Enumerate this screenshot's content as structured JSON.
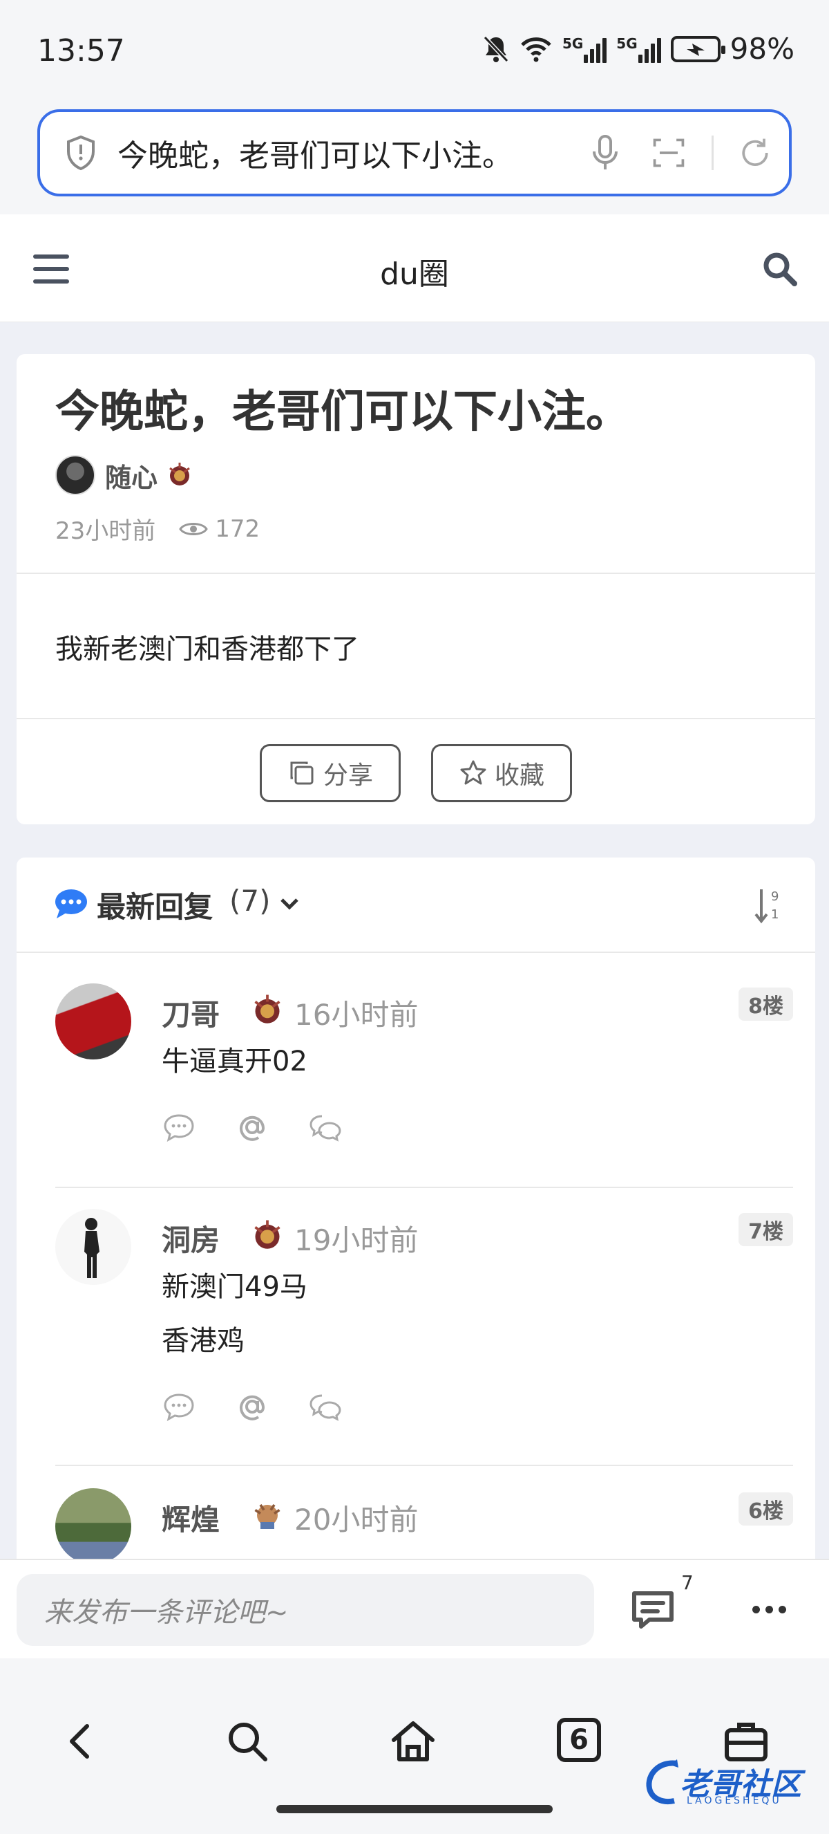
{
  "status_bar": {
    "time": "13:57",
    "network": "5G",
    "battery": "98%"
  },
  "address_bar": {
    "text": "今晚蛇，老哥们可以下小注。"
  },
  "header": {
    "title": "du圈"
  },
  "post": {
    "title": "今晚蛇，老哥们可以下小注。",
    "author": "随心",
    "time": "23小时前",
    "views": "172",
    "body": "我新老澳门和香港都下了",
    "share_label": "分享",
    "favorite_label": "收藏"
  },
  "replies": {
    "title": "最新回复",
    "count": "(7)",
    "sort_digits": [
      "9",
      "1"
    ],
    "items": [
      {
        "name": "刀哥",
        "time": "16小时前",
        "floor": "8楼",
        "content": [
          "牛逼真开02"
        ]
      },
      {
        "name": "洞房",
        "time": "19小时前",
        "floor": "7楼",
        "content": [
          "新澳门49马",
          "香港鸡"
        ]
      },
      {
        "name": "辉煌",
        "time": "20小时前",
        "floor": "6楼",
        "content": []
      }
    ]
  },
  "comment_bar": {
    "placeholder": "来发布一条评论吧~",
    "comment_count": "7"
  },
  "bottom_nav": {
    "tab_count": "6"
  },
  "watermark": {
    "text": "老哥社区",
    "sub": "LAOGESHEQU"
  },
  "colors": {
    "accent": "#3a6ee8",
    "chat_icon": "#2f7cf6"
  }
}
